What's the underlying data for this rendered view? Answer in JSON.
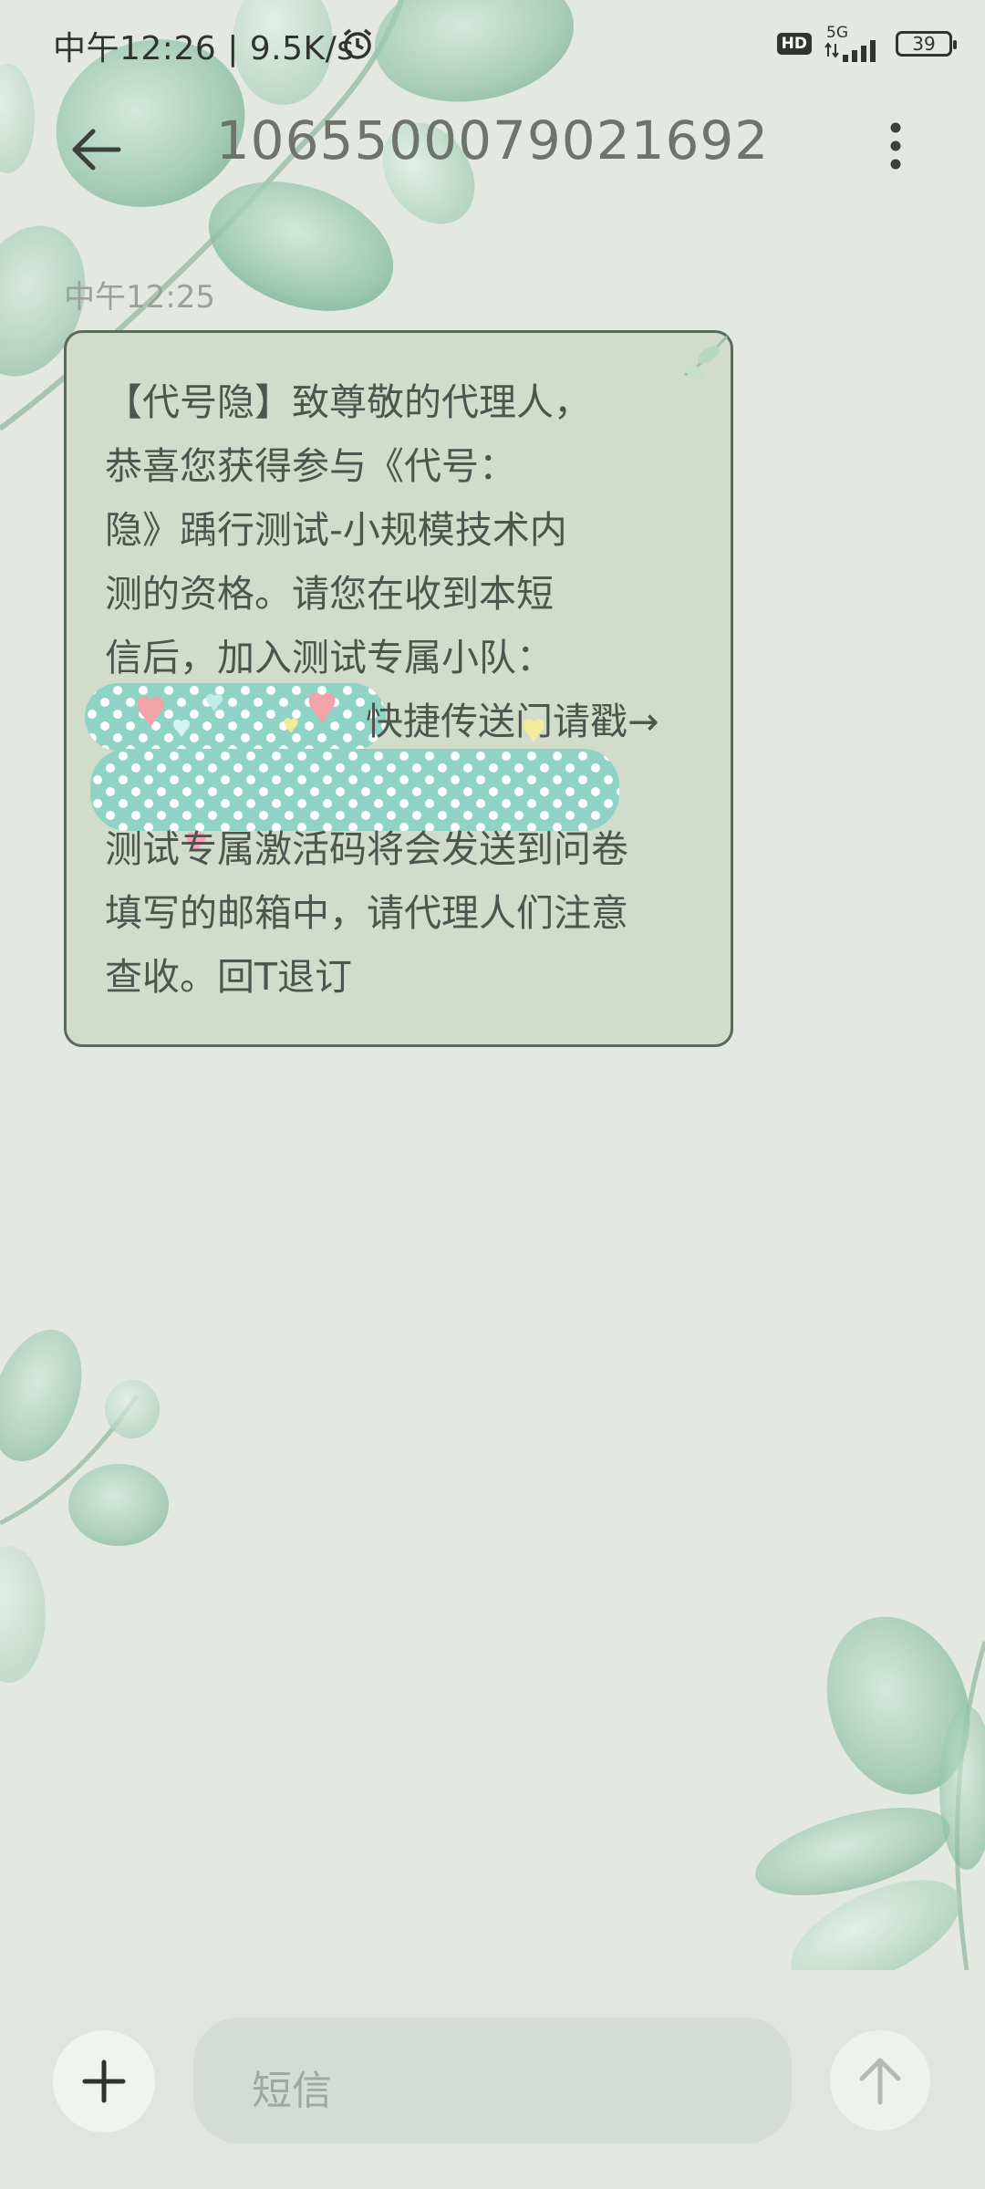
{
  "status_bar": {
    "time_speed": "中午12:26 | 9.5K/s",
    "hd": "HD",
    "network": "5G",
    "battery": "39"
  },
  "header": {
    "title": "1065500079021692",
    "back_icon": "back-arrow-icon",
    "more_icon": "more-vertical-icon"
  },
  "conversation": {
    "timestamp": "中午12:25",
    "message_lines": [
      "【代号隐】致尊敬的代理人，",
      "恭喜您获得参与《代号：",
      "隐》踽行测试-小规模技术内",
      "测的资格。请您在收到本短",
      "信后，加入测试专属小队：",
      "快捷传送门请戳→",
      "测试专属激活码将会发送到问卷",
      "填写的邮箱中，请代理人们注意",
      "查收。回T退订"
    ]
  },
  "composer": {
    "placeholder": "短信",
    "add_icon": "plus-icon",
    "send_icon": "send-arrow-icon"
  },
  "colors": {
    "background": "#e4e8e3",
    "bubble": "#d1dcca",
    "bubble_border": "#5a6a5d",
    "redaction": "#8fd3c4"
  }
}
